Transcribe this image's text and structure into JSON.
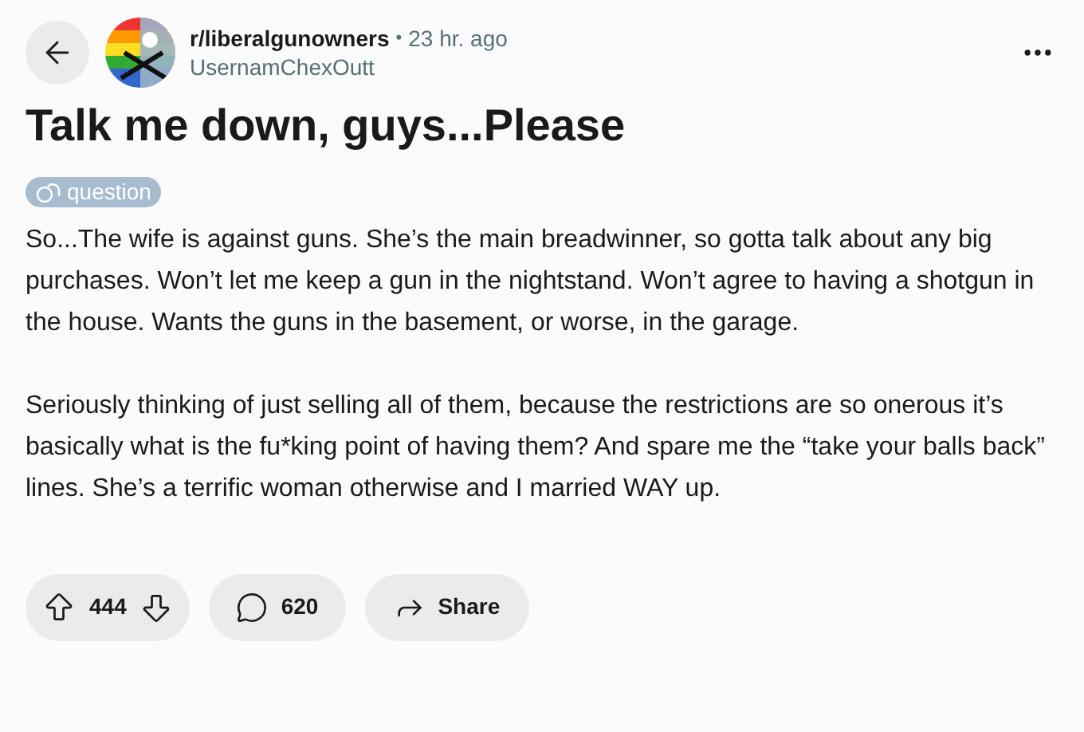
{
  "header": {
    "subreddit": "r/liberalgunowners",
    "separator": "•",
    "time": "23 hr. ago",
    "username": "UsernamChexOutt"
  },
  "title": "Talk me down, guys...Please",
  "flair": "question",
  "body": [
    "So...The wife is against guns. She’s the main breadwinner, so gotta talk about any big purchases. Won’t let me keep a gun in the nightstand. Won’t agree to having a shotgun in the house. Wants the guns in the basement, or worse, in the garage.",
    "Seriously thinking of just selling all of them, because the restrictions are so onerous it’s basically what is the fu*king point of having them? And spare me the “take your balls back” lines. She’s a terrific woman otherwise and I married WAY up."
  ],
  "actions": {
    "votes": "444",
    "comments": "620",
    "share": "Share"
  }
}
